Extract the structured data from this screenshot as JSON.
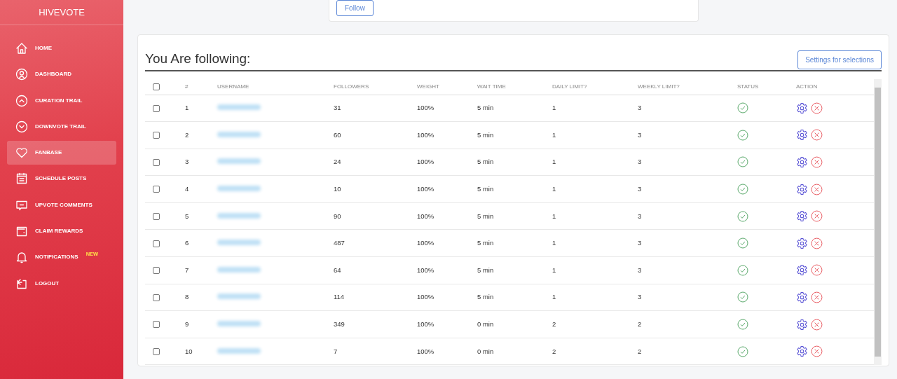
{
  "sidebar": {
    "brand": "HIVEVOTE",
    "items": [
      {
        "label": "HOME",
        "selected": false
      },
      {
        "label": "DASHBOARD",
        "selected": false
      },
      {
        "label": "CURATION TRAIL",
        "selected": false
      },
      {
        "label": "DOWNVOTE TRAIL",
        "selected": false
      },
      {
        "label": "FANBASE",
        "selected": true
      },
      {
        "label": "SCHEDULE POSTS",
        "selected": false
      },
      {
        "label": "UPVOTE COMMENTS",
        "selected": false
      },
      {
        "label": "CLAIM REWARDS",
        "selected": false
      },
      {
        "label": "NOTIFICATIONS",
        "selected": false,
        "badge": "NEW"
      },
      {
        "label": "LOGOUT",
        "selected": false
      }
    ]
  },
  "follow_button": "Follow",
  "following": {
    "title": "You Are following:",
    "settings_button": "Settings for selections",
    "table": {
      "select_all_checked": false,
      "columns": [
        "#",
        "USERNAME",
        "FOLLOWERS",
        "WEIGHT",
        "WAIT TIME",
        "DAILY LIMIT?",
        "WEEKLY LIMIT?",
        "STATUS",
        "ACTION"
      ],
      "rows": [
        {
          "checked": false,
          "number": "1",
          "followers": "31",
          "weight": "100%",
          "wait_time": "5 min",
          "daily_limit": "1",
          "weekly_limit": "3",
          "active": true
        },
        {
          "checked": false,
          "number": "2",
          "followers": "60",
          "weight": "100%",
          "wait_time": "5 min",
          "daily_limit": "1",
          "weekly_limit": "3",
          "active": true
        },
        {
          "checked": false,
          "number": "3",
          "followers": "24",
          "weight": "100%",
          "wait_time": "5 min",
          "daily_limit": "1",
          "weekly_limit": "3",
          "active": true
        },
        {
          "checked": false,
          "number": "4",
          "followers": "10",
          "weight": "100%",
          "wait_time": "5 min",
          "daily_limit": "1",
          "weekly_limit": "3",
          "active": true
        },
        {
          "checked": false,
          "number": "5",
          "followers": "90",
          "weight": "100%",
          "wait_time": "5 min",
          "daily_limit": "1",
          "weekly_limit": "3",
          "active": true
        },
        {
          "checked": false,
          "number": "6",
          "followers": "487",
          "weight": "100%",
          "wait_time": "5 min",
          "daily_limit": "1",
          "weekly_limit": "3",
          "active": true
        },
        {
          "checked": false,
          "number": "7",
          "followers": "64",
          "weight": "100%",
          "wait_time": "5 min",
          "daily_limit": "1",
          "weekly_limit": "3",
          "active": true
        },
        {
          "checked": false,
          "number": "8",
          "followers": "114",
          "weight": "100%",
          "wait_time": "5 min",
          "daily_limit": "1",
          "weekly_limit": "3",
          "active": true
        },
        {
          "checked": false,
          "number": "9",
          "followers": "349",
          "weight": "100%",
          "wait_time": "0 min",
          "daily_limit": "2",
          "weekly_limit": "2",
          "active": true
        },
        {
          "checked": false,
          "number": "10",
          "followers": "7",
          "weight": "100%",
          "wait_time": "0 min",
          "daily_limit": "2",
          "weekly_limit": "2",
          "active": true
        }
      ]
    }
  }
}
